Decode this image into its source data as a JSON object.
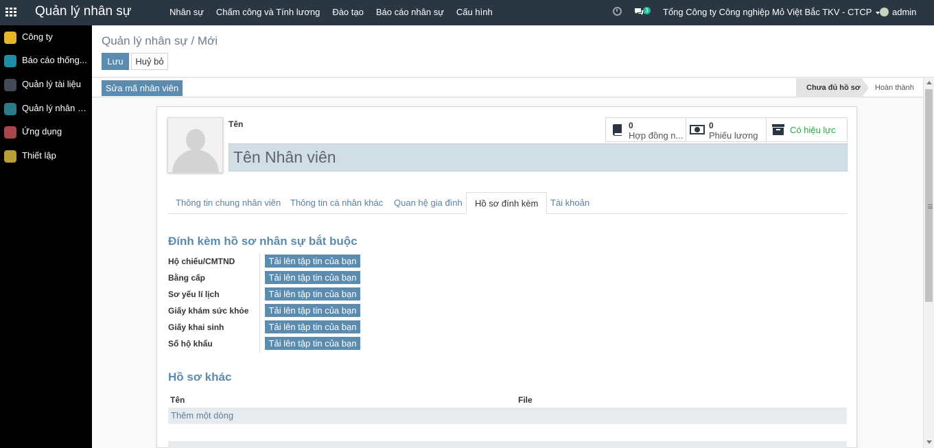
{
  "topbar": {
    "brand": "Quản lý nhân sự",
    "menu": [
      "Nhân sự",
      "Chấm công và Tính lương",
      "Đào tạo",
      "Báo cáo nhân sự",
      "Cấu hình"
    ],
    "chat_count": "3",
    "company": "Tổng Công ty Công nghiệp Mỏ Việt Bắc TKV - CTCP",
    "user": "admin"
  },
  "sidebar": {
    "items": [
      {
        "label": "Công ty",
        "icon": "building-icon",
        "color": "#e8b52a"
      },
      {
        "label": "Báo cáo thống...",
        "icon": "chart-icon",
        "color": "#1f8fa8"
      },
      {
        "label": "Quản lý tài liệu",
        "icon": "document-icon",
        "color": "#444a55"
      },
      {
        "label": "Quản lý nhân sự",
        "icon": "people-icon",
        "color": "#2c7a85"
      },
      {
        "label": "Ứng dụng",
        "icon": "apps-icon",
        "color": "#a8474b"
      },
      {
        "label": "Thiết lập",
        "icon": "gear-icon",
        "color": "#b9a035"
      }
    ]
  },
  "control_panel": {
    "breadcrumb": "Quản lý nhân sự / Mới",
    "save_label": "Lưu",
    "cancel_label": "Huỷ bỏ"
  },
  "statusbar": {
    "edit_code_label": "Sửa mã nhân viên",
    "stage_current": "Chưa đủ hồ sơ",
    "stage_next": "Hoàn thành"
  },
  "form": {
    "name_label": "Tên",
    "name_placeholder": "Tên Nhân viên",
    "smart_buttons": [
      {
        "count": "0",
        "label": "Hợp đồng n...",
        "icon": "book-icon"
      },
      {
        "count": "0",
        "label": "Phiếu lương",
        "icon": "money-icon"
      },
      {
        "label": "Có hiệu lực",
        "icon": "archive-icon"
      }
    ],
    "tabs": [
      "Thông tin chung nhân viên",
      "Thông tin cá nhân khác",
      "Quan hệ gia đình",
      "Hồ sơ đính kèm",
      "Tài khoản"
    ],
    "active_tab": "Hồ sơ đính kèm",
    "required_section_title": "Đính kèm hồ sơ nhân sự bắt buộc",
    "required_docs": [
      {
        "label": "Hộ chiếu/CMTND",
        "button": "Tải lên tập tin của bạn"
      },
      {
        "label": "Bằng cấp",
        "button": "Tải lên tập tin của bạn"
      },
      {
        "label": "Sơ yếu lí lịch",
        "button": "Tải lên tập tin của bạn"
      },
      {
        "label": "Giấy khám sức khỏe",
        "button": "Tải lên tập tin của bạn"
      },
      {
        "label": "Giấy khai sinh",
        "button": "Tải lên tập tin của bạn"
      },
      {
        "label": "Sổ hộ khẩu",
        "button": "Tải lên tập tin của bạn"
      }
    ],
    "other_section_title": "Hồ sơ khác",
    "other_table": {
      "columns": [
        "Tên",
        "File"
      ],
      "add_row_label": "Thêm một dòng"
    }
  },
  "colors": {
    "topbar_bg": "#2b3643",
    "accent": "#5c8bb0",
    "input_bg": "#d2dee6",
    "success": "#28a745"
  }
}
